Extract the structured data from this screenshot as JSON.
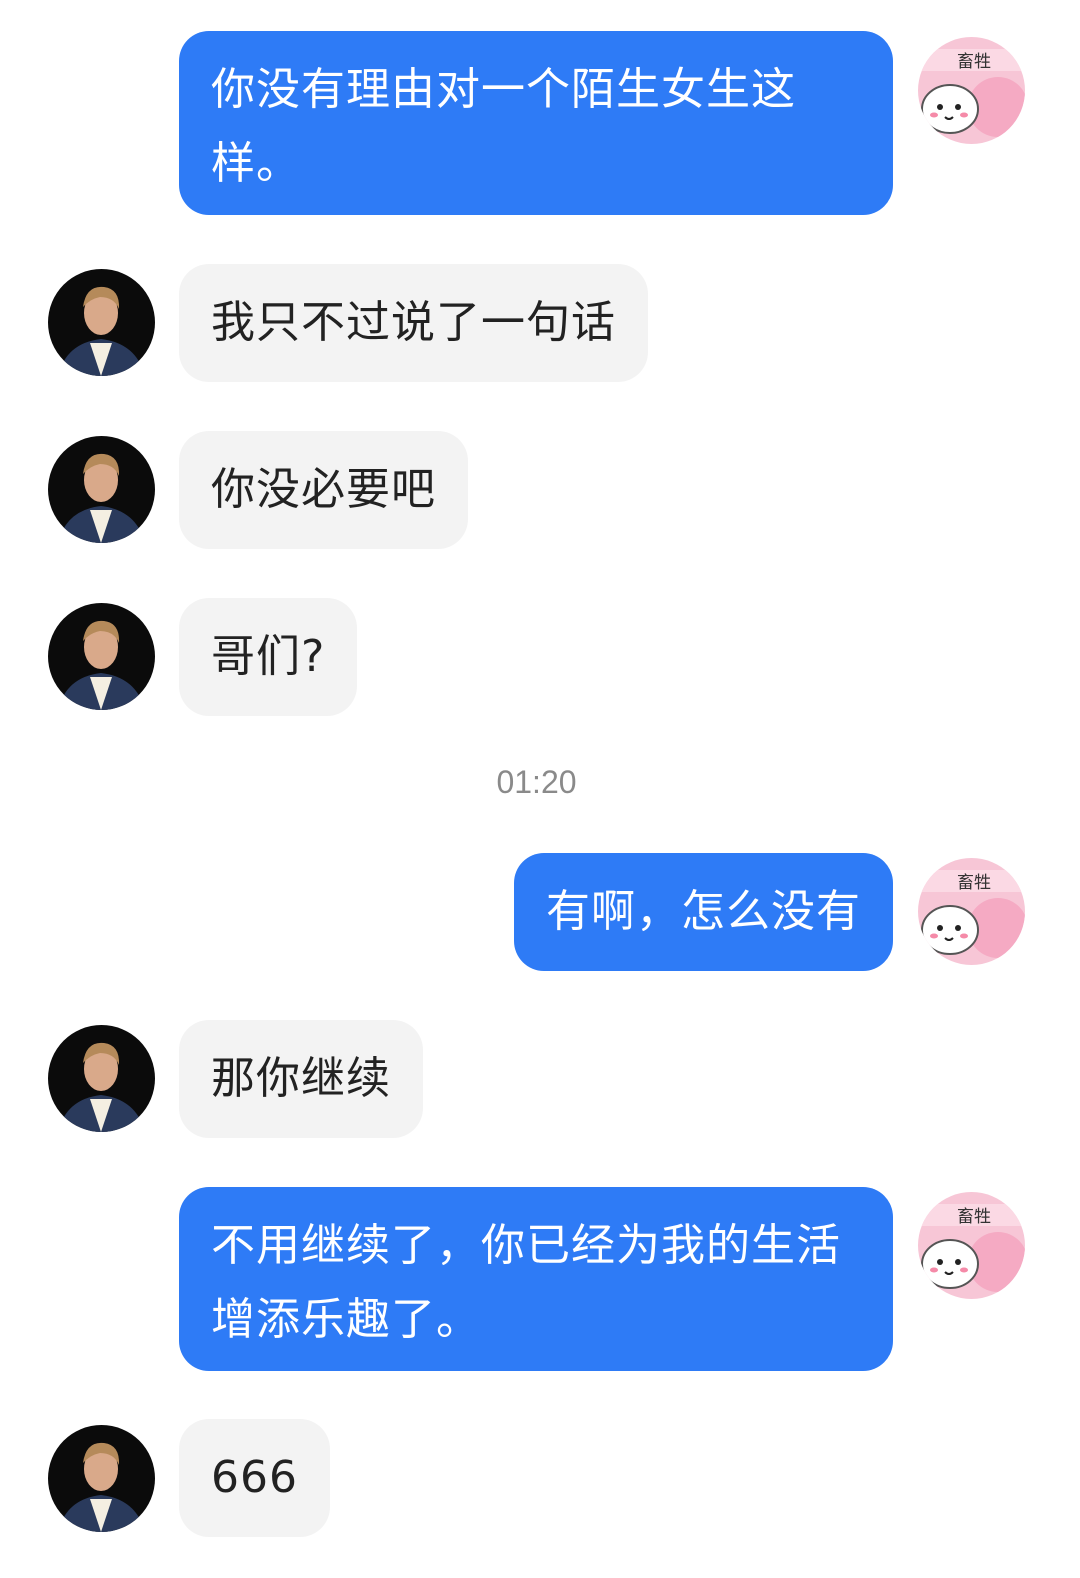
{
  "chat": {
    "timestamp": "01:20",
    "messages": [
      {
        "side": "out",
        "text": "你没有理由对一个陌生女生这样。"
      },
      {
        "side": "in",
        "text": "我只不过说了一句话"
      },
      {
        "side": "in",
        "text": "你没必要吧"
      },
      {
        "side": "in",
        "text": "哥们?"
      },
      {
        "side": "out",
        "text": "有啊，怎么没有"
      },
      {
        "side": "in",
        "text": "那你继续"
      },
      {
        "side": "out",
        "text": "不用继续了，你已经为我的生活增添乐趣了。"
      },
      {
        "side": "in",
        "text": "666"
      }
    ],
    "avatar_self_text": "畜牲",
    "colors": {
      "outgoing_bubble": "#2e7bf6",
      "incoming_bubble": "#f3f3f3",
      "timestamp": "#8a8a8a"
    },
    "icons": {
      "self_avatar": "pink-hamster-sticker-avatar",
      "other_avatar": "man-portrait-avatar"
    }
  }
}
